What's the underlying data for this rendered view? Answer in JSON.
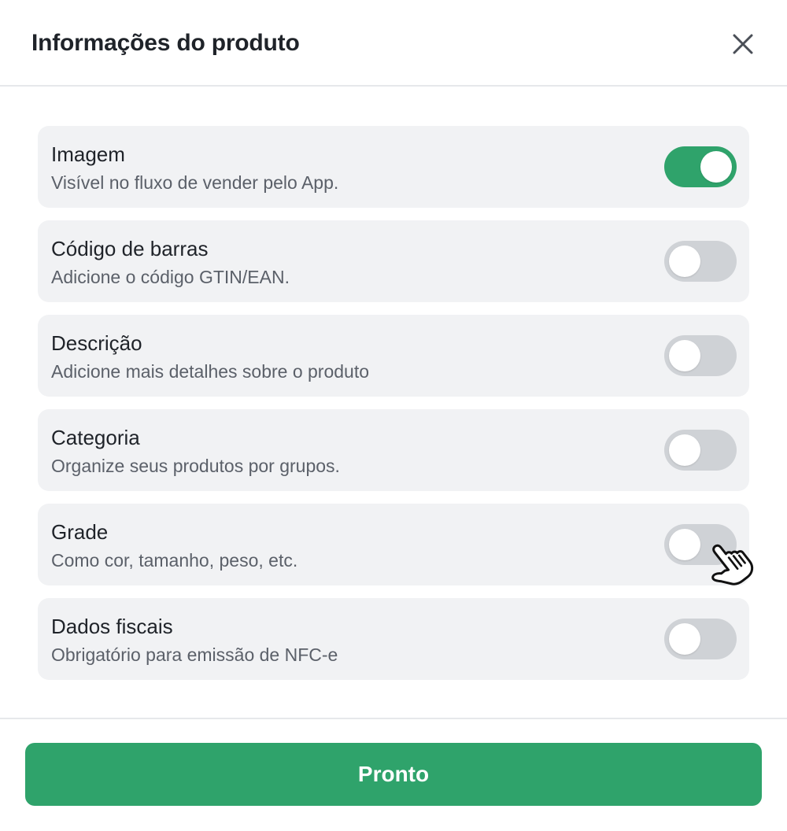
{
  "modal": {
    "title": "Informações do produto",
    "close_icon": "close-icon"
  },
  "options": [
    {
      "title": "Imagem",
      "description": "Visível no fluxo de vender pelo App.",
      "enabled": true
    },
    {
      "title": "Código de barras",
      "description": "Adicione o código GTIN/EAN.",
      "enabled": false
    },
    {
      "title": "Descrição",
      "description": "Adicione mais detalhes sobre o produto",
      "enabled": false
    },
    {
      "title": "Categoria",
      "description": "Organize seus produtos por grupos.",
      "enabled": false
    },
    {
      "title": "Grade",
      "description": "Como cor, tamanho, peso, etc.",
      "enabled": false
    },
    {
      "title": "Dados fiscais",
      "description": "Obrigatório para emissão de NFC-e",
      "enabled": false
    }
  ],
  "footer": {
    "done_label": "Pronto"
  },
  "colors": {
    "accent": "#2fa36b",
    "toggle_off": "#cfd2d6",
    "card_bg": "#f1f2f4"
  },
  "cursor_icon": "hand-pointer-icon"
}
